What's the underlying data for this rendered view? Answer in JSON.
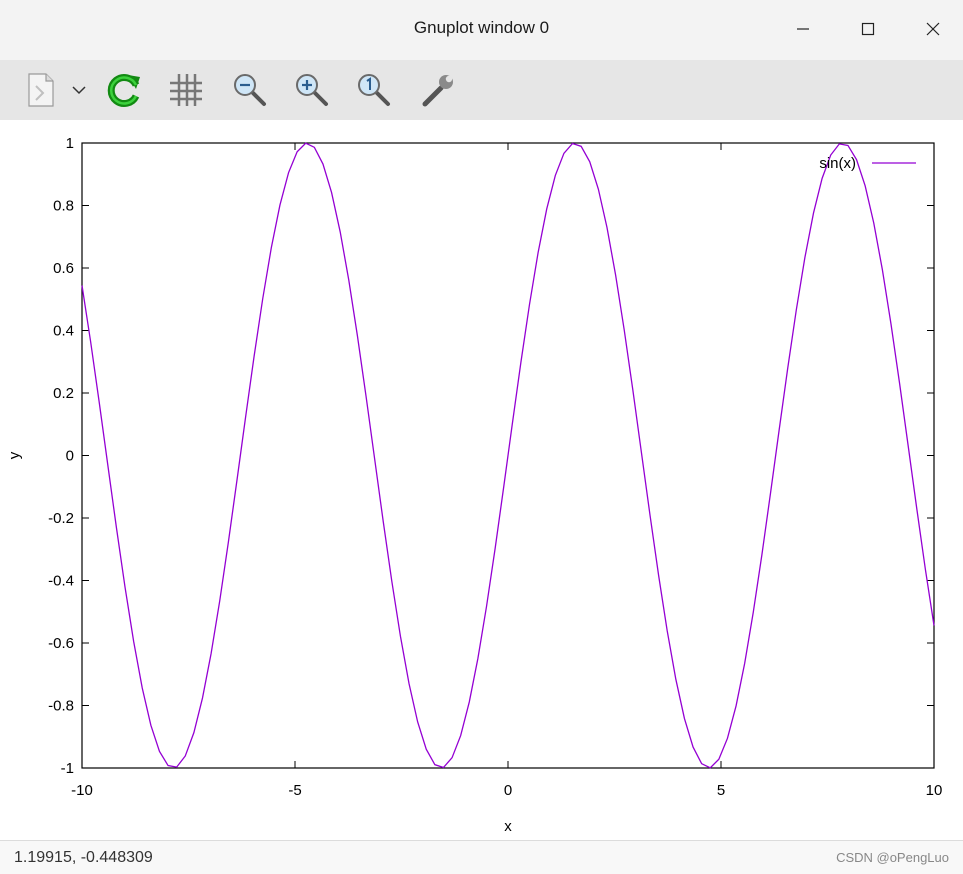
{
  "window": {
    "title": "Gnuplot window 0"
  },
  "toolbar": {
    "items": [
      "copy-icon",
      "dropdown-chevron-icon",
      "replot-icon",
      "grid-icon",
      "zoom-out-icon",
      "zoom-in-icon",
      "zoom-reset-icon",
      "options-wrench-icon"
    ]
  },
  "status": {
    "coordinates": "1.19915, -0.448309",
    "watermark": "CSDN @oPengLuo"
  },
  "colors": {
    "series": "#9400d3",
    "toolbar_bg": "#e6e6e6",
    "titlebar_bg": "#f3f3f3"
  },
  "chart_data": {
    "type": "line",
    "xlabel": "x",
    "ylabel": "y",
    "xlim": [
      -10,
      10
    ],
    "ylim": [
      -1,
      1
    ],
    "xticks": [
      "-10",
      "-5",
      "0",
      "5",
      "10"
    ],
    "yticks": [
      "1",
      "0.8",
      "0.6",
      "0.4",
      "0.2",
      "0",
      "-0.2",
      "-0.4",
      "-0.6",
      "-0.8",
      "-1"
    ],
    "grid": false,
    "legend_position": "top-right",
    "series": [
      {
        "name": "sin(x)",
        "function": "sin(x)",
        "samples": 100,
        "color": "#9400d3"
      }
    ]
  }
}
